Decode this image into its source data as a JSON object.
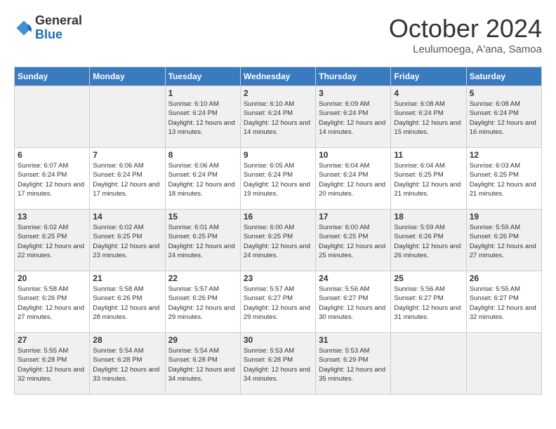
{
  "logo": {
    "general": "General",
    "blue": "Blue"
  },
  "header": {
    "month": "October 2024",
    "location": "Leulumoega, A'ana, Samoa"
  },
  "weekdays": [
    "Sunday",
    "Monday",
    "Tuesday",
    "Wednesday",
    "Thursday",
    "Friday",
    "Saturday"
  ],
  "weeks": [
    [
      null,
      null,
      {
        "day": "1",
        "sunrise": "Sunrise: 6:10 AM",
        "sunset": "Sunset: 6:24 PM",
        "daylight": "Daylight: 12 hours and 13 minutes."
      },
      {
        "day": "2",
        "sunrise": "Sunrise: 6:10 AM",
        "sunset": "Sunset: 6:24 PM",
        "daylight": "Daylight: 12 hours and 14 minutes."
      },
      {
        "day": "3",
        "sunrise": "Sunrise: 6:09 AM",
        "sunset": "Sunset: 6:24 PM",
        "daylight": "Daylight: 12 hours and 14 minutes."
      },
      {
        "day": "4",
        "sunrise": "Sunrise: 6:08 AM",
        "sunset": "Sunset: 6:24 PM",
        "daylight": "Daylight: 12 hours and 15 minutes."
      },
      {
        "day": "5",
        "sunrise": "Sunrise: 6:08 AM",
        "sunset": "Sunset: 6:24 PM",
        "daylight": "Daylight: 12 hours and 16 minutes."
      }
    ],
    [
      {
        "day": "6",
        "sunrise": "Sunrise: 6:07 AM",
        "sunset": "Sunset: 6:24 PM",
        "daylight": "Daylight: 12 hours and 17 minutes."
      },
      {
        "day": "7",
        "sunrise": "Sunrise: 6:06 AM",
        "sunset": "Sunset: 6:24 PM",
        "daylight": "Daylight: 12 hours and 17 minutes."
      },
      {
        "day": "8",
        "sunrise": "Sunrise: 6:06 AM",
        "sunset": "Sunset: 6:24 PM",
        "daylight": "Daylight: 12 hours and 18 minutes."
      },
      {
        "day": "9",
        "sunrise": "Sunrise: 6:05 AM",
        "sunset": "Sunset: 6:24 PM",
        "daylight": "Daylight: 12 hours and 19 minutes."
      },
      {
        "day": "10",
        "sunrise": "Sunrise: 6:04 AM",
        "sunset": "Sunset: 6:24 PM",
        "daylight": "Daylight: 12 hours and 20 minutes."
      },
      {
        "day": "11",
        "sunrise": "Sunrise: 6:04 AM",
        "sunset": "Sunset: 6:25 PM",
        "daylight": "Daylight: 12 hours and 21 minutes."
      },
      {
        "day": "12",
        "sunrise": "Sunrise: 6:03 AM",
        "sunset": "Sunset: 6:25 PM",
        "daylight": "Daylight: 12 hours and 21 minutes."
      }
    ],
    [
      {
        "day": "13",
        "sunrise": "Sunrise: 6:02 AM",
        "sunset": "Sunset: 6:25 PM",
        "daylight": "Daylight: 12 hours and 22 minutes."
      },
      {
        "day": "14",
        "sunrise": "Sunrise: 6:02 AM",
        "sunset": "Sunset: 6:25 PM",
        "daylight": "Daylight: 12 hours and 23 minutes."
      },
      {
        "day": "15",
        "sunrise": "Sunrise: 6:01 AM",
        "sunset": "Sunset: 6:25 PM",
        "daylight": "Daylight: 12 hours and 24 minutes."
      },
      {
        "day": "16",
        "sunrise": "Sunrise: 6:00 AM",
        "sunset": "Sunset: 6:25 PM",
        "daylight": "Daylight: 12 hours and 24 minutes."
      },
      {
        "day": "17",
        "sunrise": "Sunrise: 6:00 AM",
        "sunset": "Sunset: 6:25 PM",
        "daylight": "Daylight: 12 hours and 25 minutes."
      },
      {
        "day": "18",
        "sunrise": "Sunrise: 5:59 AM",
        "sunset": "Sunset: 6:26 PM",
        "daylight": "Daylight: 12 hours and 26 minutes."
      },
      {
        "day": "19",
        "sunrise": "Sunrise: 5:59 AM",
        "sunset": "Sunset: 6:26 PM",
        "daylight": "Daylight: 12 hours and 27 minutes."
      }
    ],
    [
      {
        "day": "20",
        "sunrise": "Sunrise: 5:58 AM",
        "sunset": "Sunset: 6:26 PM",
        "daylight": "Daylight: 12 hours and 27 minutes."
      },
      {
        "day": "21",
        "sunrise": "Sunrise: 5:58 AM",
        "sunset": "Sunset: 6:26 PM",
        "daylight": "Daylight: 12 hours and 28 minutes."
      },
      {
        "day": "22",
        "sunrise": "Sunrise: 5:57 AM",
        "sunset": "Sunset: 6:26 PM",
        "daylight": "Daylight: 12 hours and 29 minutes."
      },
      {
        "day": "23",
        "sunrise": "Sunrise: 5:57 AM",
        "sunset": "Sunset: 6:27 PM",
        "daylight": "Daylight: 12 hours and 29 minutes."
      },
      {
        "day": "24",
        "sunrise": "Sunrise: 5:56 AM",
        "sunset": "Sunset: 6:27 PM",
        "daylight": "Daylight: 12 hours and 30 minutes."
      },
      {
        "day": "25",
        "sunrise": "Sunrise: 5:56 AM",
        "sunset": "Sunset: 6:27 PM",
        "daylight": "Daylight: 12 hours and 31 minutes."
      },
      {
        "day": "26",
        "sunrise": "Sunrise: 5:55 AM",
        "sunset": "Sunset: 6:27 PM",
        "daylight": "Daylight: 12 hours and 32 minutes."
      }
    ],
    [
      {
        "day": "27",
        "sunrise": "Sunrise: 5:55 AM",
        "sunset": "Sunset: 6:28 PM",
        "daylight": "Daylight: 12 hours and 32 minutes."
      },
      {
        "day": "28",
        "sunrise": "Sunrise: 5:54 AM",
        "sunset": "Sunset: 6:28 PM",
        "daylight": "Daylight: 12 hours and 33 minutes."
      },
      {
        "day": "29",
        "sunrise": "Sunrise: 5:54 AM",
        "sunset": "Sunset: 6:28 PM",
        "daylight": "Daylight: 12 hours and 34 minutes."
      },
      {
        "day": "30",
        "sunrise": "Sunrise: 5:53 AM",
        "sunset": "Sunset: 6:28 PM",
        "daylight": "Daylight: 12 hours and 34 minutes."
      },
      {
        "day": "31",
        "sunrise": "Sunrise: 5:53 AM",
        "sunset": "Sunset: 6:29 PM",
        "daylight": "Daylight: 12 hours and 35 minutes."
      },
      null,
      null
    ]
  ]
}
